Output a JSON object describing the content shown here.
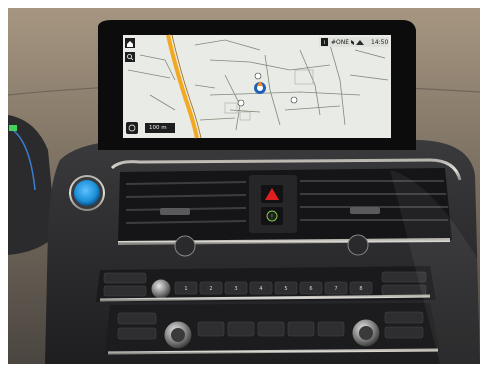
{
  "screen": {
    "status_bar": {
      "station_label": "#ONE",
      "clock": "14:50"
    },
    "scale": {
      "value": "100 m"
    }
  },
  "colors": {
    "map_background": "#e9ebe6",
    "map_road": "#7f8a7a",
    "highway": "#f2a81f",
    "start_button": "#1b8fd8",
    "hazard_icon": "#e02020",
    "display_bezel": "#0c0c0c"
  },
  "icons": [
    "home-icon",
    "search-icon",
    "info-icon",
    "mute-icon",
    "settings-icon",
    "compass-icon",
    "hazard-triangle-icon",
    "start-stop-icon"
  ]
}
